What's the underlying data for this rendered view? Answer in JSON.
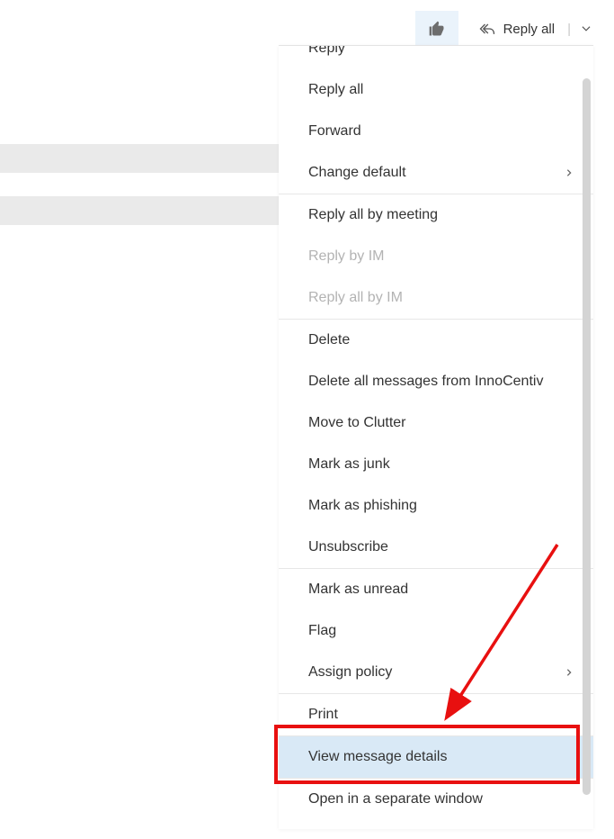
{
  "toolbar": {
    "reply_all_label": "Reply all"
  },
  "menu": {
    "items": [
      {
        "label": "Reply",
        "type": "item",
        "first": true
      },
      {
        "label": "Reply all",
        "type": "item"
      },
      {
        "label": "Forward",
        "type": "item"
      },
      {
        "label": "Change default",
        "type": "item",
        "submenu": true
      },
      {
        "type": "divider"
      },
      {
        "label": "Reply all by meeting",
        "type": "item"
      },
      {
        "label": "Reply by IM",
        "type": "item",
        "disabled": true
      },
      {
        "label": "Reply all by IM",
        "type": "item",
        "disabled": true
      },
      {
        "type": "divider"
      },
      {
        "label": "Delete",
        "type": "item"
      },
      {
        "label": "Delete all messages from InnoCentiv",
        "type": "item"
      },
      {
        "label": "Move to Clutter",
        "type": "item"
      },
      {
        "label": "Mark as junk",
        "type": "item"
      },
      {
        "label": "Mark as phishing",
        "type": "item"
      },
      {
        "label": "Unsubscribe",
        "type": "item"
      },
      {
        "type": "divider"
      },
      {
        "label": "Mark as unread",
        "type": "item"
      },
      {
        "label": "Flag",
        "type": "item"
      },
      {
        "label": "Assign policy",
        "type": "item",
        "submenu": true
      },
      {
        "type": "divider"
      },
      {
        "label": "Print",
        "type": "item"
      },
      {
        "type": "divider"
      },
      {
        "label": "View message details",
        "type": "item",
        "highlight": true
      },
      {
        "type": "divider"
      },
      {
        "label": "Open in a separate window",
        "type": "item"
      }
    ]
  }
}
